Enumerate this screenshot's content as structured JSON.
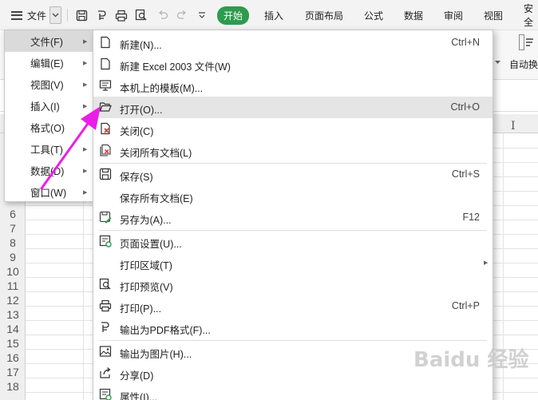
{
  "toolbar": {
    "file_label": "文件",
    "tabs": [
      "开始",
      "插入",
      "页面布局",
      "公式",
      "数据",
      "审阅",
      "视图",
      "安全"
    ]
  },
  "ribbon": {
    "autowrap_label": "自动换"
  },
  "sheet": {
    "row_numbers": [
      "6",
      "7",
      "8",
      "9",
      "10",
      "11",
      "12",
      "13",
      "14",
      "15",
      "16",
      "17",
      "18"
    ]
  },
  "left_menu": {
    "items": [
      {
        "label": "文件(F)",
        "submenu": true
      },
      {
        "label": "编辑(E)",
        "submenu": true
      },
      {
        "label": "视图(V)",
        "submenu": true
      },
      {
        "label": "插入(I)",
        "submenu": true
      },
      {
        "label": "格式(O)",
        "submenu": false
      },
      {
        "label": "工具(T)",
        "submenu": true
      },
      {
        "label": "数据(D)",
        "submenu": true
      },
      {
        "label": "窗口(W)",
        "submenu": true
      }
    ]
  },
  "file_menu": {
    "items": [
      {
        "label": "新建(N)...",
        "shortcut": "Ctrl+N",
        "icon": "blank-doc-icon"
      },
      {
        "label": "新建 Excel 2003 文件(W)",
        "shortcut": "",
        "icon": "blank-doc-icon"
      },
      {
        "label": "本机上的模板(M)...",
        "shortcut": "",
        "icon": "monitor-icon"
      },
      {
        "label": "打开(O)...",
        "shortcut": "Ctrl+O",
        "icon": "folder-open-icon"
      },
      {
        "label": "关闭(C)",
        "shortcut": "",
        "icon": "close-doc-icon"
      },
      {
        "label": "关闭所有文档(L)",
        "shortcut": "",
        "icon": "close-all-icon"
      },
      {
        "label": "保存(S)",
        "shortcut": "Ctrl+S",
        "icon": "save-icon"
      },
      {
        "label": "保存所有文档(E)",
        "shortcut": "",
        "icon": ""
      },
      {
        "label": "另存为(A)...",
        "shortcut": "F12",
        "icon": "save-as-icon"
      },
      {
        "label": "页面设置(U)...",
        "shortcut": "",
        "icon": "page-setup-icon"
      },
      {
        "label": "打印区域(T)",
        "shortcut": "",
        "icon": ""
      },
      {
        "label": "打印预览(V)",
        "shortcut": "",
        "icon": "print-preview-icon"
      },
      {
        "label": "打印(P)...",
        "shortcut": "Ctrl+P",
        "icon": "printer-icon"
      },
      {
        "label": "输出为PDF格式(F)...",
        "shortcut": "",
        "icon": "pdf-icon"
      },
      {
        "label": "输出为图片(H)...",
        "shortcut": "",
        "icon": "image-icon"
      },
      {
        "label": "分享(D)",
        "shortcut": "",
        "icon": "share-icon"
      },
      {
        "label": "属性(I)...",
        "shortcut": "",
        "icon": "properties-icon"
      }
    ]
  },
  "colors": {
    "accent_green": "#2e9b4e",
    "arrow_magenta": "#e91fe8",
    "highlight": "#e5e5e5"
  },
  "watermark": "Baidu 经验"
}
